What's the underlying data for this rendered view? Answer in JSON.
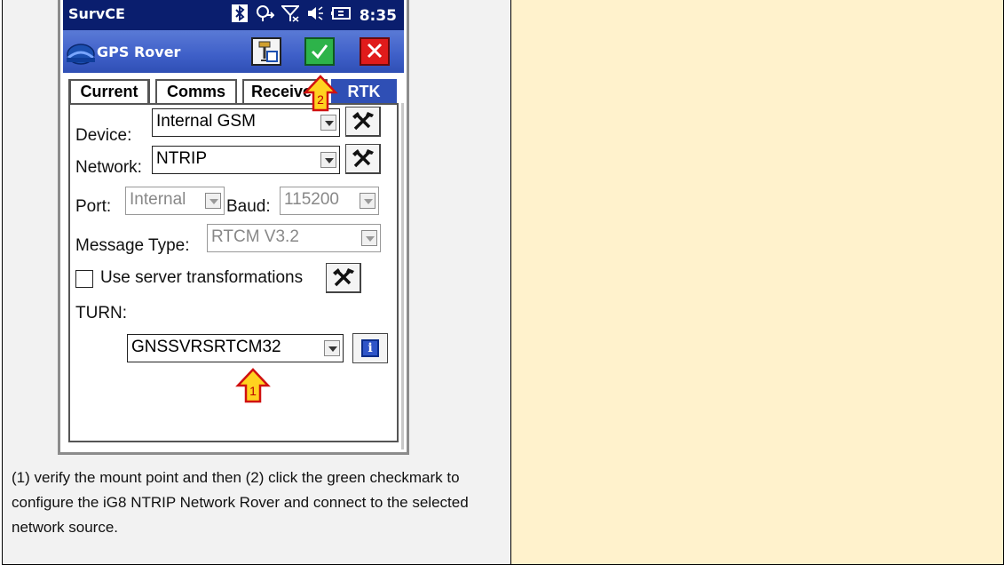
{
  "status_bar": {
    "app_name": "SurvCE",
    "time": "8:35",
    "icons": [
      "bluetooth-icon",
      "gps-icon",
      "no-signal-icon",
      "volume-icon",
      "battery-icon"
    ]
  },
  "title_bar": {
    "title": "GPS Rover",
    "ok_color": "#2db34a",
    "cancel_color": "#e01b1b"
  },
  "tabs": [
    {
      "label": "Current"
    },
    {
      "label": "Comms"
    },
    {
      "label": "Receiver"
    },
    {
      "label": "RTK",
      "active": true
    }
  ],
  "form": {
    "device_label": "Device:",
    "device_value": "Internal GSM",
    "network_label": "Network:",
    "network_value": "NTRIP",
    "port_label": "Port:",
    "port_value": "Internal",
    "baud_label": "Baud:",
    "baud_value": "115200",
    "message_type_label": "Message Type:",
    "message_type_value": "RTCM V3.2",
    "use_server_transformations_label": "Use server transformations",
    "use_server_transformations_checked": false,
    "turn_label": "TURN:",
    "mount_point_value": "GNSSVRSRTCM32",
    "info_button_glyph": "i"
  },
  "callouts": [
    {
      "number": "2"
    },
    {
      "number": "1"
    }
  ],
  "caption": "(1) verify the mount point and then (2) click the green checkmark to configure the iG8 NTRIP Network Rover and connect to the selected network source.",
  "colors": {
    "left_cell_bg": "#f2f2f2",
    "right_cell_bg": "#fff2cc",
    "status_bar_bg": "#0a1e6e",
    "title_bar_bg": "#3e5fc8"
  }
}
